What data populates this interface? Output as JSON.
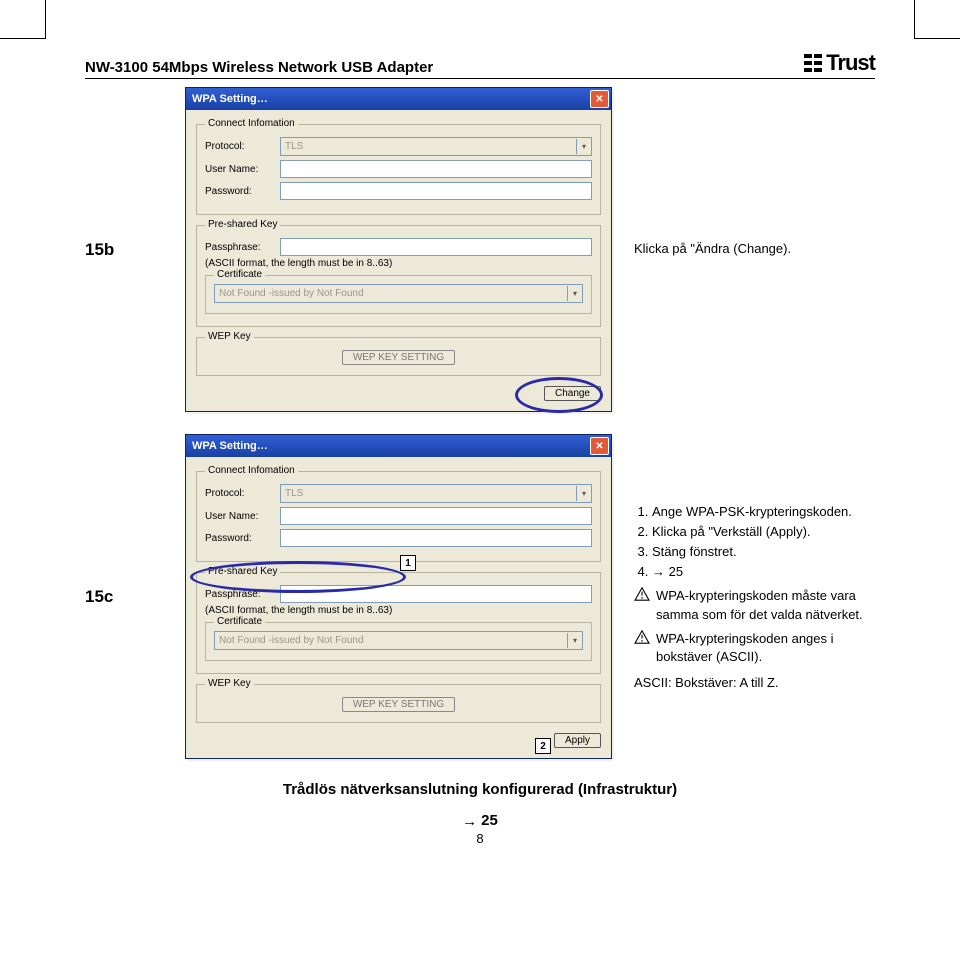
{
  "header": {
    "title": "NW-3100 54Mbps Wireless Network USB Adapter",
    "brand": "Trust"
  },
  "row_labels": {
    "b": "15b",
    "c": "15c"
  },
  "dialog": {
    "title": "WPA Setting…",
    "close_glyph": "✕",
    "groups": {
      "connect": "Connect Infomation",
      "psk": "Pre-shared Key",
      "cert": "Certificate",
      "wep": "WEP Key"
    },
    "labels": {
      "protocol": "Protocol:",
      "username": "User Name:",
      "password": "Password:",
      "passphrase": "Passphrase:",
      "ascii_hint": "(ASCII format, the length must be in 8..63)"
    },
    "values": {
      "protocol": "TLS",
      "cert": "Not Found -issued by Not Found"
    },
    "buttons": {
      "wep_setting": "WEP KEY SETTING",
      "change": "Change",
      "apply": "Apply"
    },
    "chevron": "▾"
  },
  "instructions": {
    "b": "Klicka på \"Ändra (Change).",
    "c_items": [
      "Ange WPA-PSK-krypteringskoden.",
      "Klicka på \"Verkställ (Apply).",
      "Stäng fönstret.",
      "→ 25"
    ],
    "warn1": "WPA-krypteringskoden måste vara samma som för det valda nätverket.",
    "warn2": "WPA-krypteringskoden anges i bokstäver (ASCII).",
    "ascii_note": "ASCII: Bokstäver: A till Z."
  },
  "markers": {
    "one": "1",
    "two": "2"
  },
  "footer": {
    "line": "Trådlös nätverksanslutning konfigurerad (Infrastruktur)",
    "goto": "25",
    "page": "8"
  }
}
